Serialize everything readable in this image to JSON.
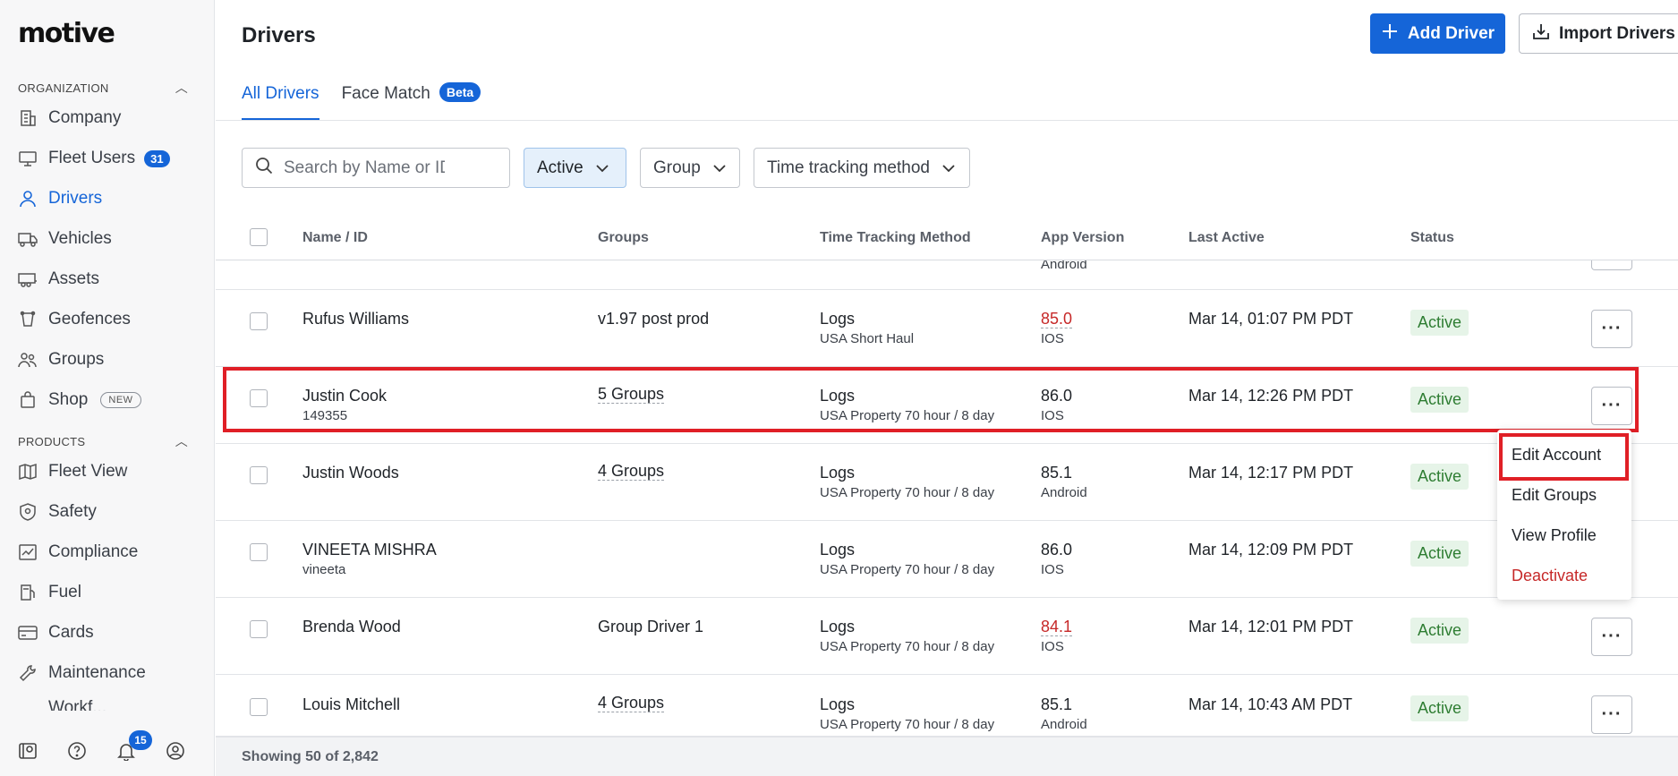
{
  "brand": {
    "logo": "motive"
  },
  "sidebar": {
    "organization_label": "ORGANIZATION",
    "products_label": "PRODUCTS",
    "org_items": [
      {
        "label": "Company",
        "icon": "building-icon"
      },
      {
        "label": "Fleet Users",
        "icon": "monitor-icon",
        "badge": "31"
      },
      {
        "label": "Drivers",
        "icon": "person-icon",
        "active": true
      },
      {
        "label": "Vehicles",
        "icon": "truck-icon"
      },
      {
        "label": "Assets",
        "icon": "trailer-icon"
      },
      {
        "label": "Geofences",
        "icon": "geofence-icon"
      },
      {
        "label": "Groups",
        "icon": "people-icon"
      },
      {
        "label": "Shop",
        "icon": "bag-icon",
        "tag": "NEW"
      }
    ],
    "product_items": [
      {
        "label": "Fleet View",
        "icon": "map-icon"
      },
      {
        "label": "Safety",
        "icon": "shield-icon"
      },
      {
        "label": "Compliance",
        "icon": "chart-icon"
      },
      {
        "label": "Fuel",
        "icon": "fuel-icon"
      },
      {
        "label": "Cards",
        "icon": "card-icon"
      },
      {
        "label": "Maintenance",
        "icon": "wrench-icon"
      },
      {
        "label": "Workf...",
        "icon": "workforce-icon"
      }
    ],
    "notifications_count": "15"
  },
  "header": {
    "title": "Drivers",
    "add_driver": "Add Driver",
    "import_drivers": "Import Drivers"
  },
  "tabs": [
    {
      "label": "All Drivers",
      "active": true
    },
    {
      "label": "Face Match",
      "badge": "Beta"
    }
  ],
  "filters": {
    "search_placeholder": "Search by Name or ID",
    "status": "Active",
    "group": "Group",
    "time_tracking": "Time tracking method"
  },
  "table": {
    "columns": [
      "Name / ID",
      "Groups",
      "Time Tracking Method",
      "App Version",
      "Last Active",
      "Status"
    ],
    "partial_row_app": "Android",
    "rows": [
      {
        "name": "Rufus Williams",
        "id": "",
        "groups": "v1.97 post prod",
        "groups_dotted": false,
        "method": "Logs",
        "method_sub": "USA Short Haul",
        "version": "85.0",
        "version_warn": true,
        "platform": "IOS",
        "last_active": "Mar 14, 01:07 PM PDT",
        "status": "Active"
      },
      {
        "name": "Justin Cook",
        "id": "149355",
        "groups": "5 Groups",
        "groups_dotted": true,
        "method": "Logs",
        "method_sub": "USA Property 70 hour / 8 day",
        "version": "86.0",
        "version_warn": false,
        "platform": "IOS",
        "last_active": "Mar 14, 12:26 PM PDT",
        "status": "Active"
      },
      {
        "name": "Justin Woods",
        "id": "",
        "groups": "4 Groups",
        "groups_dotted": true,
        "method": "Logs",
        "method_sub": "USA Property 70 hour / 8 day",
        "version": "85.1",
        "version_warn": false,
        "platform": "Android",
        "last_active": "Mar 14, 12:17 PM PDT",
        "status": "Active"
      },
      {
        "name": "VINEETA MISHRA",
        "id": "vineeta",
        "groups": "",
        "groups_dotted": false,
        "method": "Logs",
        "method_sub": "USA Property 70 hour / 8 day",
        "version": "86.0",
        "version_warn": false,
        "platform": "IOS",
        "last_active": "Mar 14, 12:09 PM PDT",
        "status": "Active"
      },
      {
        "name": "Brenda Wood",
        "id": "",
        "groups": "Group Driver 1",
        "groups_dotted": false,
        "method": "Logs",
        "method_sub": "USA Property 70 hour / 8 day",
        "version": "84.1",
        "version_warn": true,
        "platform": "IOS",
        "last_active": "Mar 14, 12:01 PM PDT",
        "status": "Active"
      },
      {
        "name": "Louis Mitchell",
        "id": "",
        "groups": "4 Groups",
        "groups_dotted": true,
        "method": "Logs",
        "method_sub": "USA Property 70 hour / 8 day",
        "version": "85.1",
        "version_warn": false,
        "platform": "Android",
        "last_active": "Mar 14, 10:43 AM PDT",
        "status": "Active"
      }
    ]
  },
  "row_menu": {
    "items": [
      "Edit Account",
      "Edit Groups",
      "View Profile",
      "Deactivate"
    ]
  },
  "footer": {
    "showing": "Showing 50 of 2,842"
  }
}
